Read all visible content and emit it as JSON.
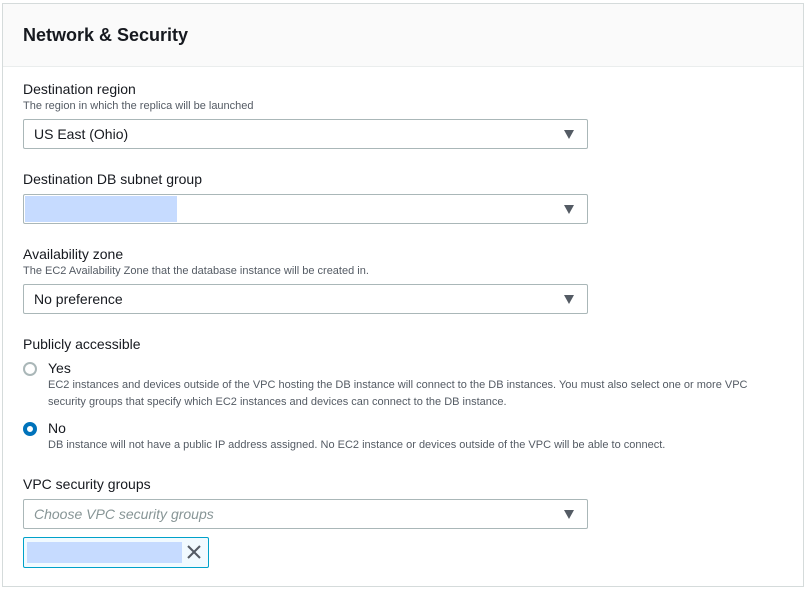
{
  "panel": {
    "title": "Network & Security"
  },
  "destination_region": {
    "label": "Destination region",
    "description": "The region in which the replica will be launched",
    "value": "US East (Ohio)"
  },
  "destination_subnet": {
    "label": "Destination DB subnet group",
    "value": ""
  },
  "availability_zone": {
    "label": "Availability zone",
    "description": "The EC2 Availability Zone that the database instance will be created in.",
    "value": "No preference"
  },
  "public_access": {
    "label": "Publicly accessible",
    "options": [
      {
        "label": "Yes",
        "description": "EC2 instances and devices outside of the VPC hosting the DB instance will connect to the DB instances. You must also select one or more VPC security groups that specify which EC2 instances and devices can connect to the DB instance.",
        "selected": false
      },
      {
        "label": "No",
        "description": "DB instance will not have a public IP address assigned. No EC2 instance or devices outside of the VPC will be able to connect.",
        "selected": true
      }
    ]
  },
  "vpc_security_groups": {
    "label": "VPC security groups",
    "placeholder": "Choose VPC security groups",
    "selected_tokens": [
      ""
    ]
  },
  "colors": {
    "accent": "#0073bb",
    "token_border": "#00a1c9",
    "redaction": "#c6dbff",
    "border": "#aab7b8"
  },
  "icons": {
    "dropdown": "caret-down-icon",
    "token_remove": "close-icon"
  }
}
